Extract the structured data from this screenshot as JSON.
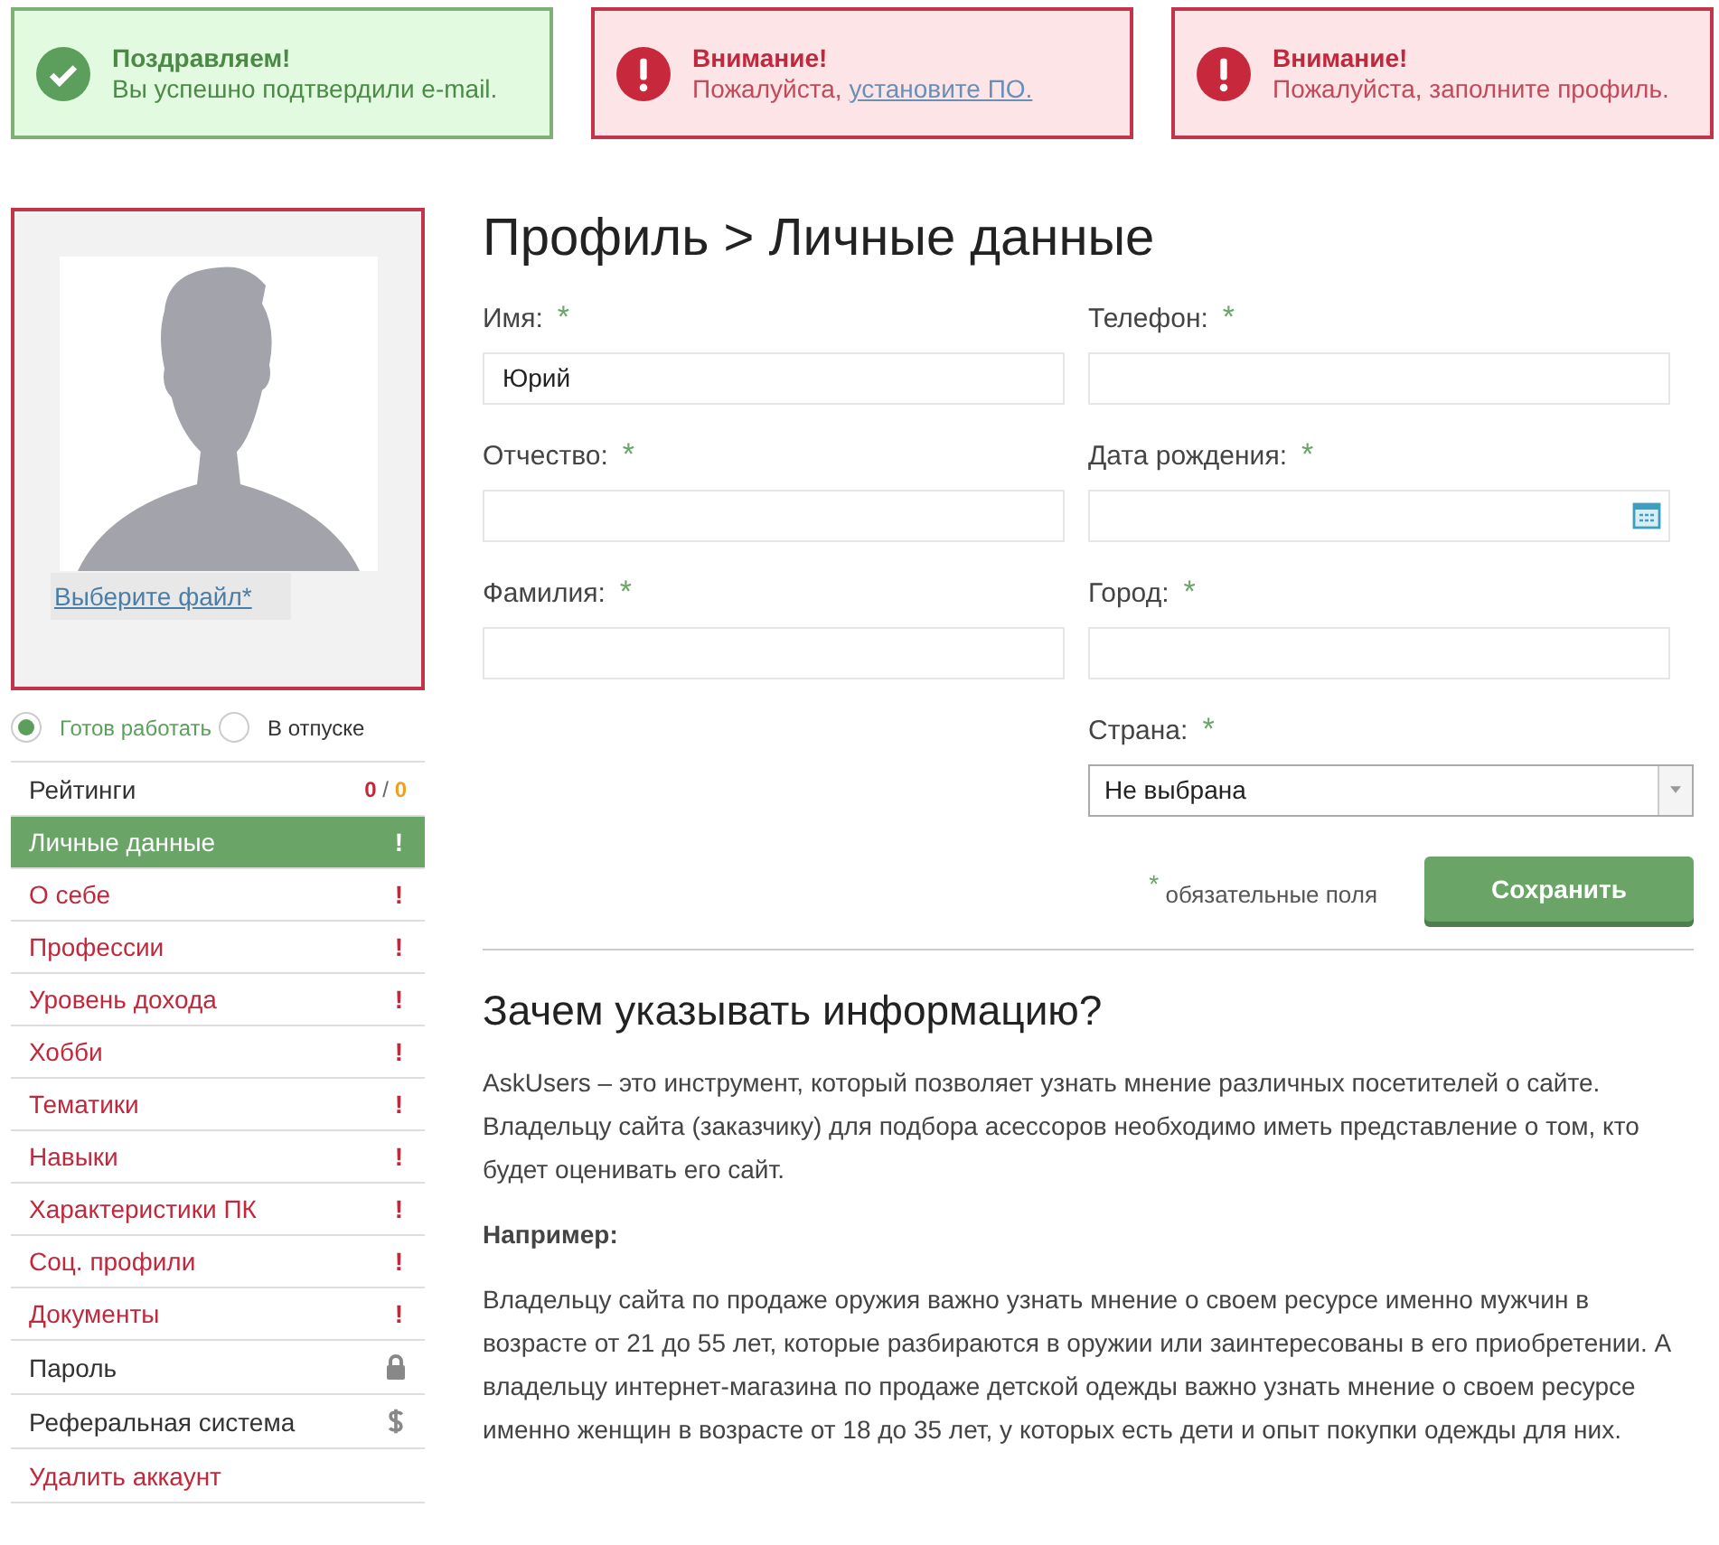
{
  "alerts": [
    {
      "kind": "success",
      "title": "Поздравляем!",
      "message": "Вы успешно подтвердили e-mail."
    },
    {
      "kind": "error",
      "title": "Внимание!",
      "message": "Пожалуйста,",
      "link": "установите ПО."
    },
    {
      "kind": "error",
      "title": "Внимание!",
      "message": "Пожалуйста, заполните профиль."
    }
  ],
  "avatar": {
    "file_link": "Выберите файл*"
  },
  "status_options": [
    {
      "label": "Готов работать",
      "selected": true
    },
    {
      "label": "В отпуске",
      "selected": false
    }
  ],
  "sidebar": {
    "items": [
      {
        "kind": "rating",
        "label": "Рейтинги",
        "score": "0",
        "separator": "/",
        "max": "0",
        "selected": false
      },
      {
        "kind": "alert",
        "label": "Личные данные",
        "marker": "!",
        "selected": true
      },
      {
        "kind": "alert",
        "label": "О себе",
        "marker": "!",
        "selected": false
      },
      {
        "kind": "alert",
        "label": "Профессии",
        "marker": "!",
        "selected": false
      },
      {
        "kind": "alert",
        "label": "Уровень дохода",
        "marker": "!",
        "selected": false
      },
      {
        "kind": "alert",
        "label": "Хобби",
        "marker": "!",
        "selected": false
      },
      {
        "kind": "alert",
        "label": "Тематики",
        "marker": "!",
        "selected": false
      },
      {
        "kind": "alert",
        "label": "Навыки",
        "marker": "!",
        "selected": false
      },
      {
        "kind": "alert",
        "label": "Характеристики ПК",
        "marker": "!",
        "selected": false
      },
      {
        "kind": "alert",
        "label": "Соц. профили",
        "marker": "!",
        "selected": false
      },
      {
        "kind": "alert",
        "label": "Документы",
        "marker": "!",
        "selected": false
      },
      {
        "kind": "lock",
        "label": "Пароль",
        "selected": false
      },
      {
        "kind": "dollar",
        "label": "Реферальная система",
        "selected": false
      },
      {
        "kind": "danger",
        "label": "Удалить аккаунт",
        "selected": false
      }
    ]
  },
  "page_title": "Профиль > Личные данные",
  "form": {
    "fields": [
      {
        "kind": "text",
        "label": "Имя:",
        "required": "*",
        "value": "Юрий"
      },
      {
        "kind": "text",
        "label": "Телефон:",
        "required": "*"
      },
      {
        "kind": "text",
        "label": "Отчество:",
        "required": "*"
      },
      {
        "kind": "date",
        "label": "Дата рождения:",
        "required": "*"
      },
      {
        "kind": "text",
        "label": "Фамилия:",
        "required": "*"
      },
      {
        "kind": "text",
        "label": "Город:",
        "required": "*"
      },
      {
        "kind": "spacer"
      },
      {
        "kind": "select",
        "label": "Страна:",
        "required": "*",
        "value": "Не выбрана"
      }
    ],
    "required_mark": "*",
    "required_note": "обязательные поля",
    "save_button": "Сохранить"
  },
  "info": {
    "title": "Зачем указывать информацию?",
    "paragraphs": [
      {
        "kind": "text",
        "text": "AskUsers – это инструмент, который позволяет узнать мнение различных посетителей о сайте. Владельцу сайта (заказчику) для подбора асессоров необходимо иметь представление о том, кто будет оценивать его сайт."
      },
      {
        "kind": "heading",
        "text": "Например:"
      },
      {
        "kind": "text",
        "text": "Владельцу сайта по продаже оружия важно узнать мнение о своем ресурсе именно мужчин в возрасте от 21 до 55 лет, которые разбираются в оружии или заинтересованы в его приобретении. А владельцу интернет-магазина по продаже детской одежды важно узнать мнение о своем ресурсе именно женщин в возрасте от 18 до 35 лет, у которых есть дети и опыт покупки одежды для них."
      }
    ]
  }
}
